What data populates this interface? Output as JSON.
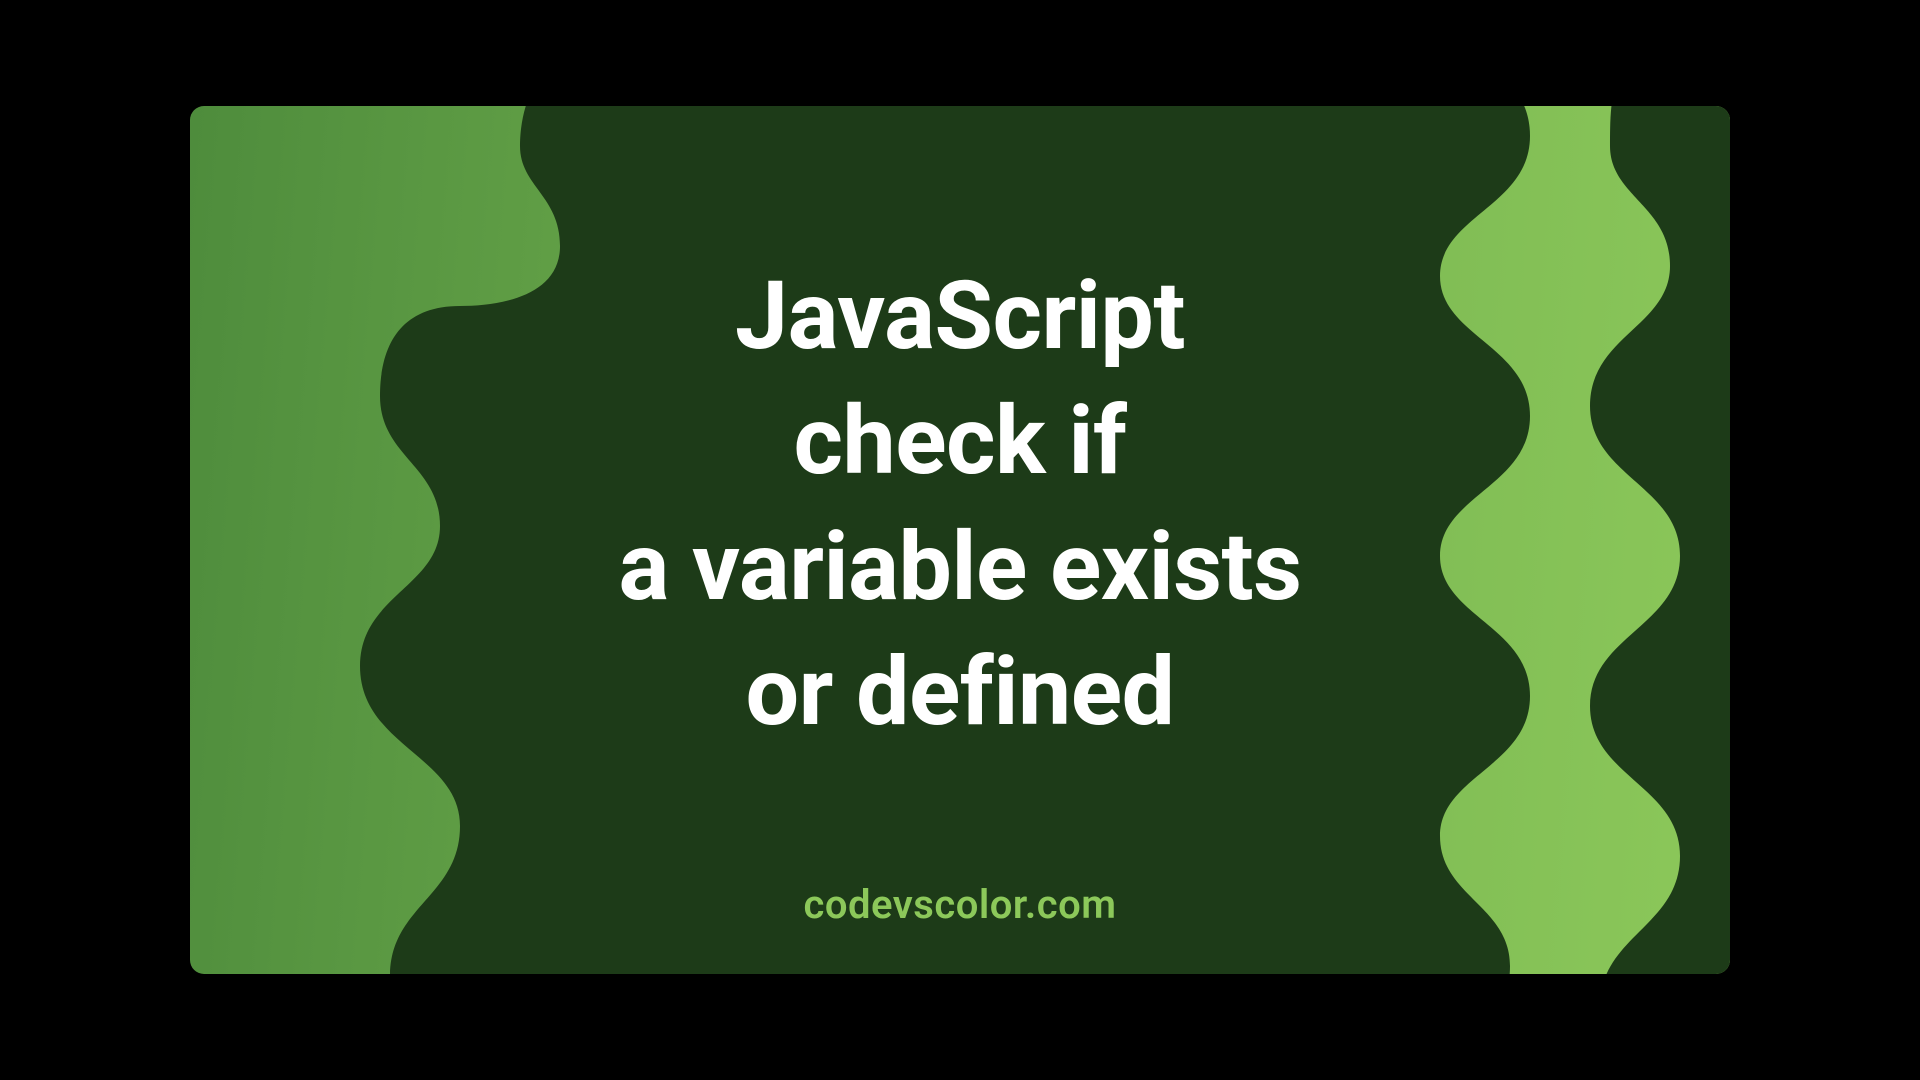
{
  "title_line1": "JavaScript",
  "title_line2": "check if",
  "title_line3": "a variable exists",
  "title_line4": "or defined",
  "attribution": "codevscolor.com",
  "colors": {
    "gradient_start": "#4e8c3c",
    "gradient_end": "#8cc85a",
    "blob": "#1d3b18",
    "text": "#ffffff",
    "attribution": "#8cc85a"
  }
}
